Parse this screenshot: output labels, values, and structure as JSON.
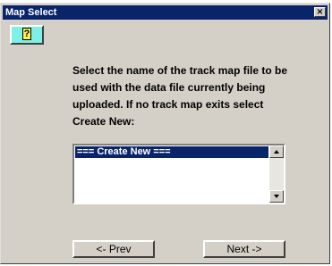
{
  "window": {
    "title": "Map Select",
    "close_glyph": "×"
  },
  "help_button": {
    "glyph": "?",
    "icon": "help-question-icon"
  },
  "instructions": "Select the name of the track map file to be\nused with the data file currently being\nuploaded. If no track map exits select\nCreate New:",
  "map_list": {
    "items": [
      "=== Create New ==="
    ],
    "selected_index": 0
  },
  "buttons": {
    "prev_label": "<- Prev",
    "next_label": "Next ->"
  },
  "colors": {
    "titlebar": "#0a246a",
    "face": "#d4d0c8",
    "help_button": "#7df0e8",
    "selection": "#0a246a"
  }
}
